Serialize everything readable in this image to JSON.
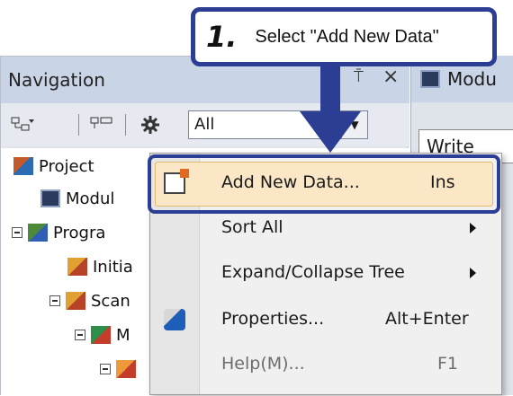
{
  "callout": {
    "step": "1.",
    "text": "Select \"Add New Data\""
  },
  "navigation": {
    "title": "Navigation",
    "pin_glyph": "⍑",
    "close_glyph": "×",
    "filter_value": "All",
    "tree": [
      {
        "label": "Project",
        "icon": "project-icon"
      },
      {
        "label": "Modul",
        "icon": "module-icon"
      },
      {
        "label": "Progra",
        "icon": "program-icon"
      },
      {
        "label": "Initia",
        "icon": "initial-icon"
      },
      {
        "label": "Scan",
        "icon": "scan-icon"
      },
      {
        "label": "M",
        "icon": "main-icon"
      },
      {
        "label": "",
        "icon": "program-block-icon"
      }
    ]
  },
  "module_panel": {
    "title": "Modu",
    "write_label": "Write"
  },
  "context_menu": {
    "items": [
      {
        "label": "Add New Data...",
        "shortcut": "Ins",
        "icon": "add-data-icon"
      },
      {
        "label": "Sort All",
        "submenu": true
      },
      {
        "label": "Expand/Collapse Tree",
        "submenu": true
      },
      {
        "label": "Properties...",
        "shortcut": "Alt+Enter",
        "icon": "properties-icon"
      },
      {
        "label": "Help(M)...",
        "shortcut": "F1",
        "disabled": true
      }
    ]
  },
  "colors": {
    "callout_border": "#2c3e93",
    "highlight": "#fbe7c6"
  }
}
